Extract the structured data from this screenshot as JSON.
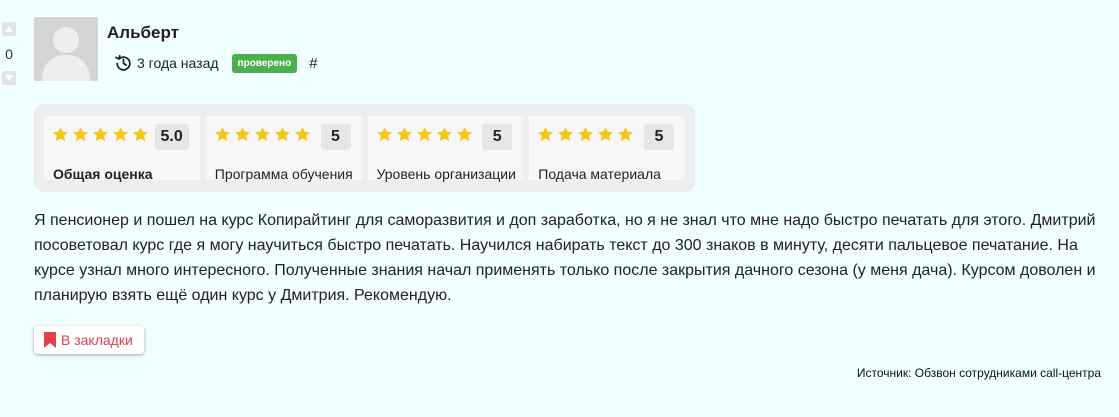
{
  "vote": {
    "count": "0"
  },
  "author": {
    "name": "Альберт"
  },
  "meta": {
    "date": "3 года назад",
    "badge": "проверено",
    "anchor": "#"
  },
  "ratings": [
    {
      "label": "Общая оценка",
      "score": "5.0",
      "stars": 5
    },
    {
      "label": "Программа обучения",
      "score": "5",
      "stars": 5
    },
    {
      "label": "Уровень организации",
      "score": "5",
      "stars": 5
    },
    {
      "label": "Подача материала",
      "score": "5",
      "stars": 5
    }
  ],
  "review": {
    "text": "Я пенсионер и пошел на курс Копирайтинг для саморазвития и доп заработка, но я не знал что мне надо быстро печатать для этого. Дмитрий посоветовал курс где я могу научиться быстро печатать. Научился набирать текст до 300 знаков в минуту, десяти пальцевое печатание. На курсе узнал много интересного. Полученные знания начал применять только после закрытия дачного сезона (у меня дача). Курсом доволен и планирую взять ещё один курс у Дмитрия. Рекомендую."
  },
  "bookmark": {
    "label": "В закладки"
  },
  "source": {
    "text": "Источник: Обзвон сотрудниками call-центра"
  },
  "colors": {
    "star": "#f5c518",
    "badge": "#4cae4c",
    "bookmark": "#e2404f",
    "background": "#f0ffff"
  },
  "icons": {
    "vote_up": "caret-up-icon",
    "vote_down": "caret-down-icon",
    "date": "history-icon",
    "bookmark": "bookmark-icon",
    "rating": "star-icon"
  }
}
